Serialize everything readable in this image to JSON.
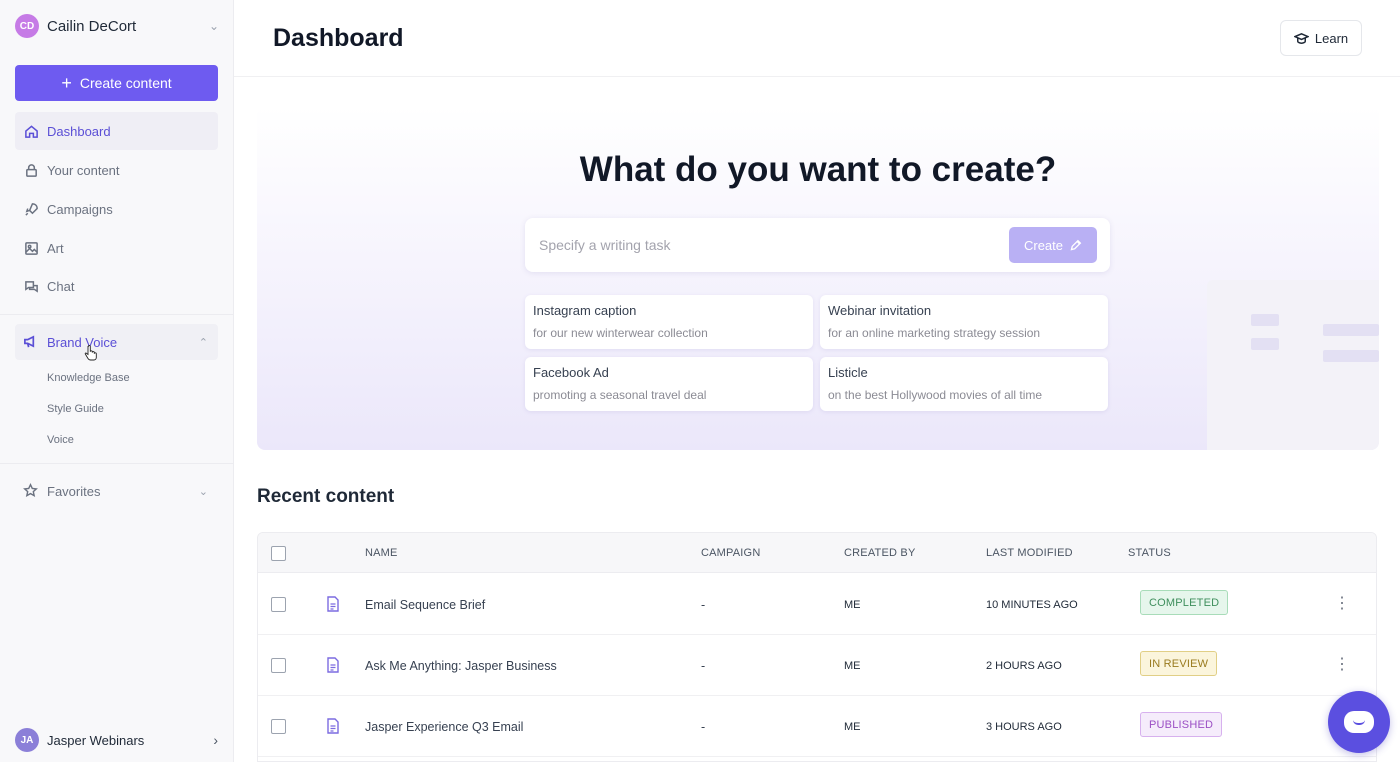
{
  "sidebar": {
    "user": {
      "initials": "CD",
      "name": "Cailin DeCort"
    },
    "create_label": "Create content",
    "nav": [
      {
        "label": "Dashboard",
        "icon": "home-icon"
      },
      {
        "label": "Your content",
        "icon": "lock-icon"
      },
      {
        "label": "Campaigns",
        "icon": "rocket-icon"
      },
      {
        "label": "Art",
        "icon": "image-icon"
      },
      {
        "label": "Chat",
        "icon": "chat-icon"
      }
    ],
    "brand_voice": {
      "label": "Brand Voice",
      "sub_items": [
        "Knowledge Base",
        "Style Guide",
        "Voice"
      ]
    },
    "favorites_label": "Favorites",
    "workspace": {
      "initials": "JA",
      "name": "Jasper Webinars"
    }
  },
  "header": {
    "title": "Dashboard",
    "learn_label": "Learn"
  },
  "hero": {
    "title": "What do you want to create?",
    "input_placeholder": "Specify a writing task",
    "create_label": "Create",
    "suggestions": [
      {
        "title": "Instagram caption",
        "subtitle": "for our new winterwear collection"
      },
      {
        "title": "Webinar invitation",
        "subtitle": "for an online marketing strategy session"
      },
      {
        "title": "Facebook Ad",
        "subtitle": "promoting a seasonal travel deal"
      },
      {
        "title": "Listicle",
        "subtitle": "on the best Hollywood movies of all time"
      }
    ]
  },
  "recent": {
    "title": "Recent content",
    "columns": [
      "NAME",
      "CAMPAIGN",
      "CREATED BY",
      "LAST MODIFIED",
      "STATUS"
    ],
    "rows": [
      {
        "name": "Email Sequence Brief",
        "campaign": "-",
        "created_by": "ME",
        "last_modified": "10 MINUTES AGO",
        "status": "COMPLETED"
      },
      {
        "name": "Ask Me Anything: Jasper Business",
        "campaign": "-",
        "created_by": "ME",
        "last_modified": "2 HOURS AGO",
        "status": "IN REVIEW"
      },
      {
        "name": "Jasper Experience Q3 Email",
        "campaign": "-",
        "created_by": "ME",
        "last_modified": "3 HOURS AGO",
        "status": "PUBLISHED"
      }
    ]
  },
  "colors": {
    "accent": "#6e5bf0",
    "completed_bg": "#e6f6ec",
    "completed_fg": "#3f8f5d",
    "completed_border": "#a8dcb9",
    "review_bg": "#fbf5dc",
    "review_fg": "#9a7b1f",
    "review_border": "#e1cf86",
    "published_bg": "#f5ecfb",
    "published_fg": "#9b4fc4",
    "published_border": "#d7b1ee"
  }
}
